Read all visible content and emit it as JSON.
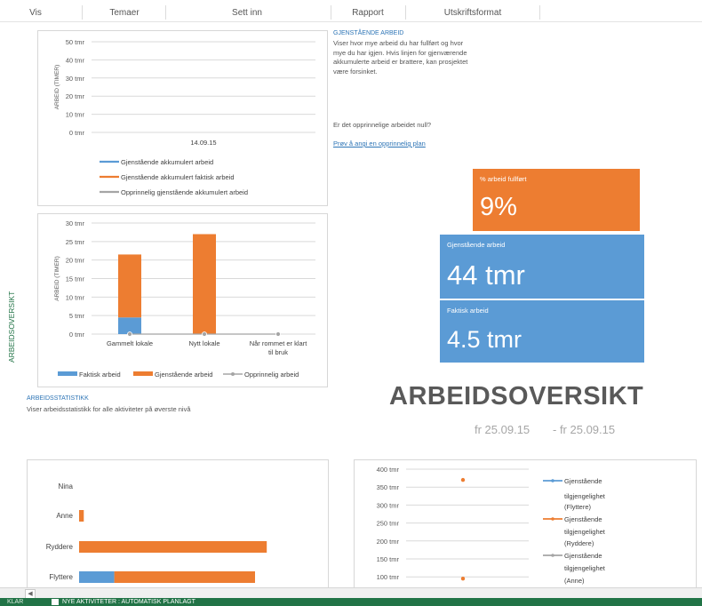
{
  "ribbon": {
    "tabs": [
      "Vis",
      "Temaer",
      "Sett inn",
      "Rapport",
      "Utskriftsformat"
    ]
  },
  "side_label": "ARBEIDSOVERSIKT",
  "info": {
    "heading": "GJENSTÅENDE ARBEID",
    "lines": [
      "Viser hvor mye arbeid du har fullført og hvor",
      "mye du har igjen. Hvis linjen for gjenværende",
      "akkumulerte arbeid er brattere, kan prosjektet",
      "være forsinket."
    ],
    "question": "Er det opprinnelige arbeidet null?",
    "link": "Prøv å angi en opprinnelig plan"
  },
  "tiles": {
    "percent": {
      "label": "% arbeid fullført",
      "value": "9%",
      "color": "#ed7d31"
    },
    "remaining": {
      "label": "Gjenstående arbeid",
      "value": "44 tmr",
      "color": "#5b9bd5"
    },
    "actual": {
      "label": "Faktisk arbeid",
      "value": "4.5 tmr",
      "color": "#5b9bd5"
    }
  },
  "title": "ARBEIDSOVERSIKT",
  "dates": {
    "start": "fr 25.09.15",
    "end": "- fr 25.09.15"
  },
  "stats": {
    "heading": "ARBEIDSSTATISTIKK",
    "text": "Viser arbeidsstatistikk for alle aktiviteter på øverste nivå"
  },
  "chart_data": [
    {
      "type": "line",
      "ylabel": "ARBEID (TIMER)",
      "yticks": [
        "50 tmr",
        "40 tmr",
        "30 tmr",
        "20 tmr",
        "10 tmr",
        "0 tmr"
      ],
      "ylim": [
        0,
        50
      ],
      "categories": [
        "14.09.15"
      ],
      "series": [
        {
          "name": "Gjenstående akkumulert arbeid",
          "color": "#5b9bd5",
          "values": []
        },
        {
          "name": "Gjenstående akkumulert faktisk arbeid",
          "color": "#ed7d31",
          "values": []
        },
        {
          "name": "Opprinnelig gjenstående akkumulert arbeid",
          "color": "#a5a5a5",
          "values": []
        }
      ],
      "legend": "bottom"
    },
    {
      "type": "bar",
      "stacked": true,
      "ylabel": "ARBEID (TIMER)",
      "yticks": [
        "30 tmr",
        "25 tmr",
        "20 tmr",
        "15 tmr",
        "10 tmr",
        "5 tmr",
        "0 tmr"
      ],
      "ylim": [
        0,
        30
      ],
      "categories": [
        "Gammelt lokale",
        "Nytt lokale",
        "Når rommet er klart til bruk"
      ],
      "series": [
        {
          "name": "Faktisk arbeid",
          "color": "#5b9bd5",
          "values": [
            4.5,
            0,
            0
          ]
        },
        {
          "name": "Gjenstående arbeid",
          "color": "#ed7d31",
          "values": [
            17,
            27,
            0
          ]
        },
        {
          "name": "Opprinnelig arbeid",
          "color": "#a5a5a5",
          "values": [
            0,
            0,
            0
          ]
        }
      ],
      "legend": "bottom"
    },
    {
      "type": "bar",
      "orientation": "horizontal",
      "stacked": true,
      "categories": [
        "Nina",
        "Anne",
        "Ryddere",
        "Flyttere"
      ],
      "series": [
        {
          "name": "Faktisk arbeid",
          "color": "#5b9bd5",
          "values": [
            0,
            0,
            0,
            4.5
          ]
        },
        {
          "name": "Gjenstående arbeid",
          "color": "#ed7d31",
          "values": [
            0,
            0.6,
            24,
            18
          ]
        }
      ]
    },
    {
      "type": "line",
      "yticks": [
        "400 tmr",
        "350 tmr",
        "300 tmr",
        "250 tmr",
        "200 tmr",
        "150 tmr",
        "100 tmr"
      ],
      "ylim": [
        100,
        400
      ],
      "series": [
        {
          "name": "Gjenstående tilgjengelighet (Flyttere)",
          "color": "#5b9bd5",
          "values": []
        },
        {
          "name": "Gjenstående tilgjengelighet (Ryddere)",
          "color": "#ed7d31",
          "values": [
            370,
            95
          ]
        },
        {
          "name": "Gjenstående tilgjengelighet (Anne)",
          "color": "#a5a5a5",
          "values": []
        }
      ],
      "legend": "right"
    }
  ],
  "status": {
    "ready": "KLAR",
    "sheet": "NYE AKTIVITETER : AUTOMATISK PLANLAGT"
  }
}
